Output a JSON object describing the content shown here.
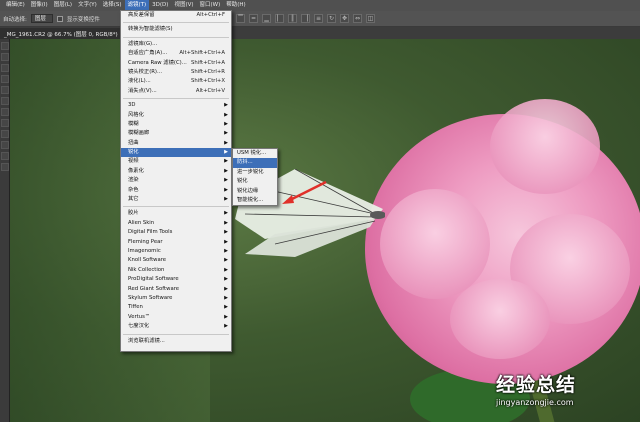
{
  "menubar": {
    "items": [
      "编辑(E)",
      "图像(I)",
      "图层(L)",
      "文字(Y)",
      "选择(S)",
      "滤镜(T)",
      "3D(D)",
      "视图(V)",
      "窗口(W)",
      "帮助(H)"
    ]
  },
  "options_bar": {
    "label_auto_select": "自动选择:",
    "select_value": "图层",
    "label_show_transform": "显示变换控件"
  },
  "document_tab": {
    "title": "_MG_1961.CR2 @ 66.7% (图层 0, RGB/8*)",
    "close": "×"
  },
  "filter_menu": {
    "items": [
      {
        "label": "高反差保留",
        "shortcut": "Alt+Ctrl+F"
      },
      {
        "sep": true
      },
      {
        "label": "转换为智能滤镜(S)"
      },
      {
        "sep": true
      },
      {
        "label": "滤镜库(G)..."
      },
      {
        "label": "自适应广角(A)...",
        "shortcut": "Alt+Shift+Ctrl+A"
      },
      {
        "label": "Camera Raw 滤镜(C)...",
        "shortcut": "Shift+Ctrl+A"
      },
      {
        "label": "镜头校正(R)...",
        "shortcut": "Shift+Ctrl+R"
      },
      {
        "label": "液化(L)...",
        "shortcut": "Shift+Ctrl+X"
      },
      {
        "label": "消失点(V)...",
        "shortcut": "Alt+Ctrl+V"
      },
      {
        "sep": true
      },
      {
        "label": "3D",
        "sub": true
      },
      {
        "label": "风格化",
        "sub": true
      },
      {
        "label": "模糊",
        "sub": true
      },
      {
        "label": "模糊画廊",
        "sub": true
      },
      {
        "label": "扭曲",
        "sub": true
      },
      {
        "label": "锐化",
        "sub": true,
        "highlight": true
      },
      {
        "label": "视频",
        "sub": true
      },
      {
        "label": "像素化",
        "sub": true
      },
      {
        "label": "渲染",
        "sub": true
      },
      {
        "label": "杂色",
        "sub": true
      },
      {
        "label": "其它",
        "sub": true
      },
      {
        "sep": true
      },
      {
        "label": "胶片",
        "sub": true
      },
      {
        "label": "Alien Skin",
        "sub": true
      },
      {
        "label": "Digital Film Tools",
        "sub": true
      },
      {
        "label": "Fleming Pear",
        "sub": true
      },
      {
        "label": "Imagenomic",
        "sub": true
      },
      {
        "label": "Knoll Software",
        "sub": true
      },
      {
        "label": "Nik Collection",
        "sub": true
      },
      {
        "label": "ProDigital Software",
        "sub": true
      },
      {
        "label": "Red Giant Software",
        "sub": true
      },
      {
        "label": "Skylum Software",
        "sub": true
      },
      {
        "label": "Tiffen",
        "sub": true
      },
      {
        "label": "Vertus™",
        "sub": true
      },
      {
        "label": "七度汉化",
        "sub": true
      },
      {
        "sep": true
      },
      {
        "label": "浏览联机滤镜..."
      }
    ]
  },
  "sharpen_submenu": {
    "items": [
      {
        "label": "USM 锐化..."
      },
      {
        "label": "防抖...",
        "highlight": true
      },
      {
        "label": "进一步锐化"
      },
      {
        "label": "锐化"
      },
      {
        "label": "锐化边缘"
      },
      {
        "label": "智能锐化..."
      }
    ]
  },
  "colors": {
    "menu_highlight": "#3d6fb8",
    "arrow": "#e0302a"
  },
  "watermark": {
    "text_cn": "经验总结",
    "url": "jingyanzongjie.com"
  }
}
